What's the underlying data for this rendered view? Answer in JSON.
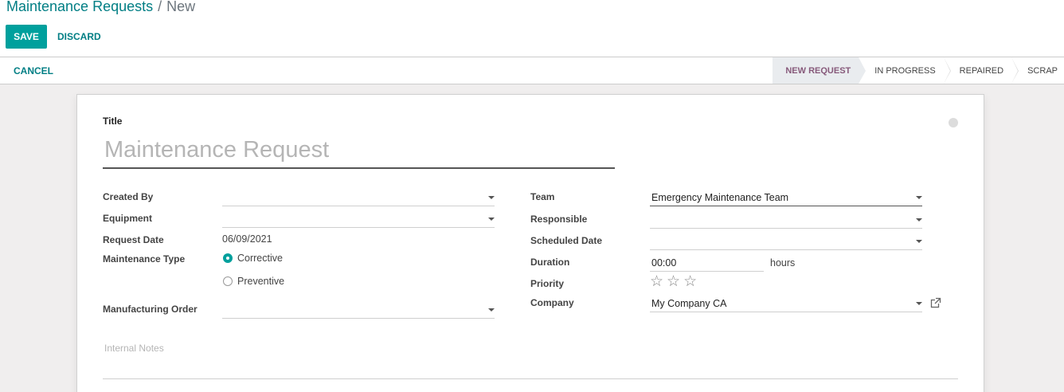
{
  "breadcrumb": {
    "parent": "Maintenance Requests",
    "separator": "/",
    "current": "New"
  },
  "toolbar": {
    "save_label": "SAVE",
    "discard_label": "DISCARD"
  },
  "statusbar": {
    "cancel_label": "CANCEL",
    "stages": [
      "NEW REQUEST",
      "IN PROGRESS",
      "REPAIRED",
      "SCRAP"
    ],
    "active_stage": "NEW REQUEST"
  },
  "form": {
    "title_label": "Title",
    "title_placeholder": "Maintenance Request",
    "left": {
      "created_by": {
        "label": "Created By",
        "value": ""
      },
      "equipment": {
        "label": "Equipment",
        "value": ""
      },
      "request_date": {
        "label": "Request Date",
        "value": "06/09/2021"
      },
      "maintenance_type": {
        "label": "Maintenance Type",
        "options": [
          "Corrective",
          "Preventive"
        ],
        "selected": "Corrective"
      },
      "manufacturing_order": {
        "label": "Manufacturing Order",
        "value": ""
      }
    },
    "right": {
      "team": {
        "label": "Team",
        "value": "Emergency Maintenance Team"
      },
      "responsible": {
        "label": "Responsible",
        "value": ""
      },
      "scheduled_date": {
        "label": "Scheduled Date",
        "value": ""
      },
      "duration": {
        "label": "Duration",
        "value": "00:00",
        "unit": "hours"
      },
      "priority": {
        "label": "Priority",
        "value": 0,
        "max": 3
      },
      "company": {
        "label": "Company",
        "value": "My Company CA"
      }
    },
    "notes_placeholder": "Internal Notes"
  },
  "colors": {
    "primary": "#00a09d",
    "link": "#017e84",
    "active_stage": "#875a7b"
  }
}
